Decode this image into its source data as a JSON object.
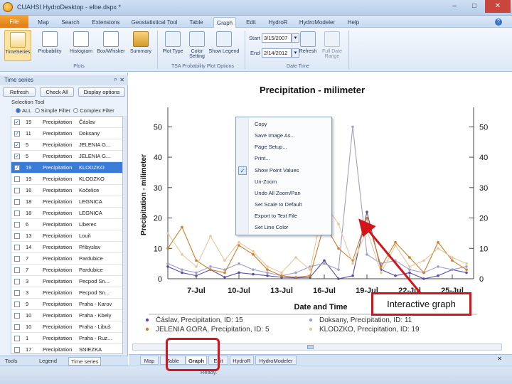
{
  "window": {
    "title": "CUAHSI HydroDesktop - elbe.dspx *",
    "minimize": "–",
    "maximize": "□",
    "close": "✕"
  },
  "menu": {
    "file": "File",
    "tabs": [
      "Map",
      "Search",
      "Extensions",
      "Geostatistical Tool",
      "Table",
      "Graph",
      "Edit",
      "HydroR",
      "HydroModeler",
      "Help"
    ],
    "help_icon": "?"
  },
  "ribbon": {
    "plots": [
      "TimeSeries",
      "Probability",
      "Histogram",
      "Box/Whisker",
      "Summary"
    ],
    "plots_group": "Plots",
    "options": [
      "Plot Type",
      "Color Setting",
      "Show Legend"
    ],
    "options_group": "TSA Probability Plot Options",
    "start_label": "Start",
    "start_value": "3/15/2007",
    "end_label": "End",
    "end_value": "2/14/2012",
    "refresh": "Refresh",
    "full_range": "Full Date Range",
    "date_group": "Date Time"
  },
  "panel": {
    "title": "Time series",
    "pin": "ᵖ",
    "close": "✕",
    "refresh_btn": "Refresh",
    "check_all_btn": "Check All",
    "display_btn": "Display options",
    "selection_tool": "Selection Tool",
    "radio_all": "ALL",
    "radio_simple": "Simple Filter",
    "radio_complex": "Complex Filter",
    "rows": [
      {
        "checked": true,
        "id": "15",
        "variable": "Precipitation",
        "site": "Čáslav",
        "highlight": false
      },
      {
        "checked": true,
        "id": "11",
        "variable": "Precipitation",
        "site": "Doksany",
        "highlight": false
      },
      {
        "checked": true,
        "id": "5",
        "variable": "Precipitation",
        "site": "JELENIA G...",
        "highlight": false
      },
      {
        "checked": true,
        "id": "5",
        "variable": "Precipitation",
        "site": "JELENIA G...",
        "highlight": false
      },
      {
        "checked": true,
        "id": "19",
        "variable": "Precipitation",
        "site": "KLODZKO",
        "highlight": true
      },
      {
        "checked": false,
        "id": "19",
        "variable": "Precipitation",
        "site": "KLODZKO",
        "highlight": false
      },
      {
        "checked": false,
        "id": "16",
        "variable": "Precipitation",
        "site": "Kočelice",
        "highlight": false
      },
      {
        "checked": false,
        "id": "18",
        "variable": "Precipitation",
        "site": "LEGNICA",
        "highlight": false
      },
      {
        "checked": false,
        "id": "18",
        "variable": "Precipitation",
        "site": "LEGNICA",
        "highlight": false
      },
      {
        "checked": false,
        "id": "6",
        "variable": "Precipitation",
        "site": "Liberec",
        "highlight": false
      },
      {
        "checked": false,
        "id": "13",
        "variable": "Precipitation",
        "site": "Louň",
        "highlight": false
      },
      {
        "checked": false,
        "id": "14",
        "variable": "Precipitation",
        "site": "Přibyslav",
        "highlight": false
      },
      {
        "checked": false,
        "id": "7",
        "variable": "Precipitation",
        "site": "Pardubice",
        "highlight": false
      },
      {
        "checked": false,
        "id": "7",
        "variable": "Precipitation",
        "site": "Pardubice",
        "highlight": false
      },
      {
        "checked": false,
        "id": "3",
        "variable": "Precipitation",
        "site": "Pecpod Sn...",
        "highlight": false
      },
      {
        "checked": false,
        "id": "3",
        "variable": "Precipitation",
        "site": "Pecpod Sn...",
        "highlight": false
      },
      {
        "checked": false,
        "id": "9",
        "variable": "Precipitation",
        "site": "Praha - Karov",
        "highlight": false
      },
      {
        "checked": false,
        "id": "10",
        "variable": "Precipitation",
        "site": "Praha - Kbely",
        "highlight": false
      },
      {
        "checked": false,
        "id": "10",
        "variable": "Precipitation",
        "site": "Praha - Libuš",
        "highlight": false
      },
      {
        "checked": false,
        "id": "1",
        "variable": "Precipitation",
        "site": "Praha - Ruz...",
        "highlight": false
      },
      {
        "checked": false,
        "id": "17",
        "variable": "Precipitation",
        "site": "SNIEZKA",
        "highlight": false
      }
    ],
    "bottom_tabs": [
      "Tools",
      "Legend",
      "Time series"
    ]
  },
  "doc_tabs": [
    "Map",
    "Table",
    "Graph",
    "Edit",
    "HydroR",
    "HydroModeler"
  ],
  "status": "Ready.",
  "context_menu": [
    "Copy",
    "Save Image As...",
    "Page Setup...",
    "Print...",
    "Show Point Values",
    "Un-Zoom",
    "Undo All Zoom/Pan",
    "Set Scale to Default",
    "Export to Text File",
    "Set Line Color"
  ],
  "annotation": "Interactive graph",
  "colors": {
    "accent": "#3a7bd5",
    "annotation": "#d3151b",
    "orange": "#e07b13"
  },
  "chart_data": {
    "type": "line",
    "title": "Precipitation - milimeter",
    "xlabel": "Date and Time",
    "ylabel": "Precipitation - milimeter",
    "ylim": [
      0,
      55
    ],
    "yticks": [
      0,
      10,
      20,
      30,
      40,
      50
    ],
    "xticks": [
      "7-Jul",
      "10-Jul",
      "13-Jul",
      "16-Jul",
      "19-Jul",
      "22-Jul",
      "25-Jul"
    ],
    "x": [
      5,
      6,
      7,
      8,
      9,
      10,
      11,
      12,
      13,
      14,
      15,
      16,
      17,
      18,
      19,
      20,
      21,
      22,
      23,
      24,
      25,
      26
    ],
    "series": [
      {
        "name": "Čáslav, Precipitation, ID: 15",
        "color": "#5a4f9e",
        "values": [
          4,
          2,
          1,
          3,
          0.5,
          2,
          1.5,
          1,
          0.5,
          0.3,
          0.5,
          6,
          0,
          1,
          22,
          3,
          1,
          2,
          0,
          1,
          3,
          2
        ]
      },
      {
        "name": "Doksany, Precipitation, ID: 11",
        "color": "#a39fcc",
        "values": [
          5,
          3,
          2,
          4,
          3,
          5,
          3,
          2,
          1,
          2,
          4,
          5,
          3,
          50,
          8,
          5,
          6,
          3,
          2,
          4,
          3,
          4
        ]
      },
      {
        "name": "JELENIA GORA, Precipitation, ID: 5",
        "color": "#d07e2c",
        "values": [
          10,
          17,
          6,
          3,
          2,
          11,
          8,
          3,
          1,
          0.5,
          1,
          18,
          10,
          6,
          20,
          4,
          12,
          7,
          2,
          12,
          6,
          3
        ]
      },
      {
        "name": "KLODZKO, Precipitation, ID: 19",
        "color": "#e9c79a",
        "values": [
          15,
          8,
          4,
          14,
          6,
          12,
          9,
          4,
          2,
          7,
          3,
          25,
          18,
          5,
          16,
          2,
          11,
          4,
          6,
          10,
          7,
          5
        ]
      }
    ],
    "legend_position": "bottom",
    "grid": false
  }
}
